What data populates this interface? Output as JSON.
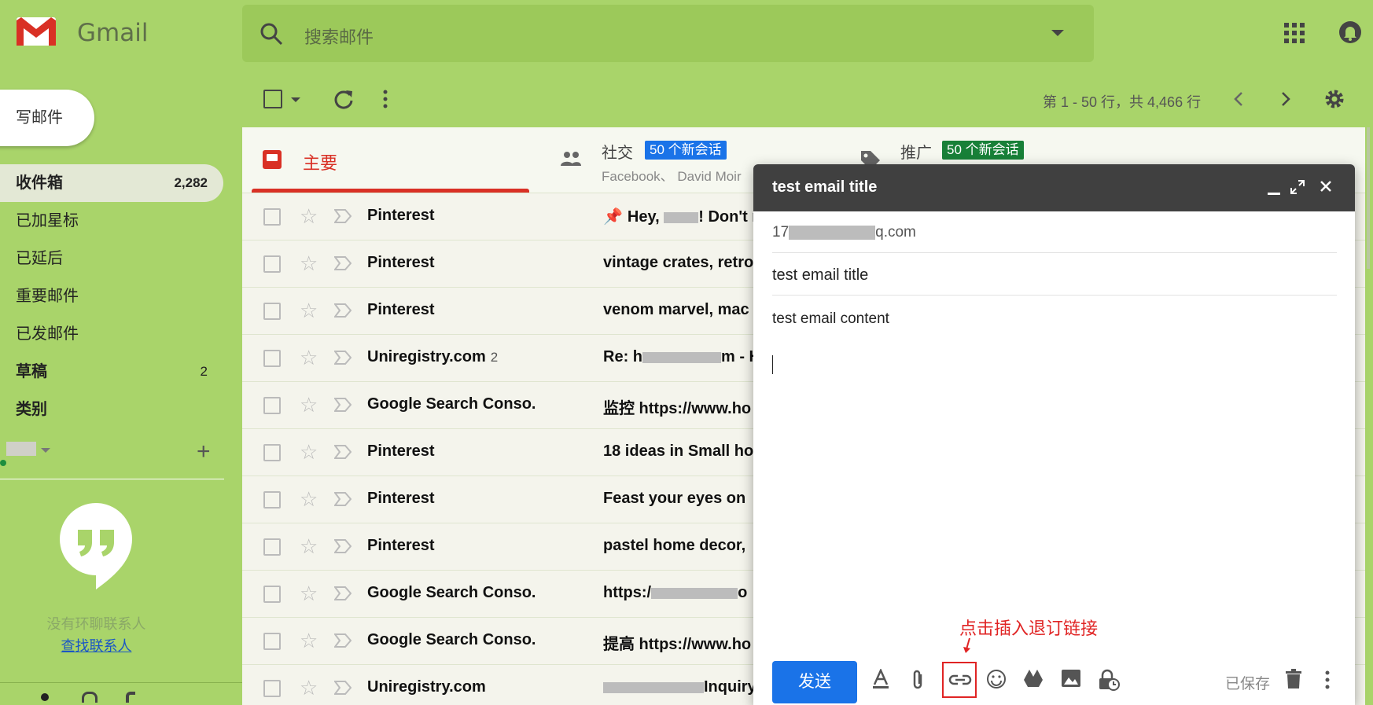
{
  "header": {
    "logo_text": "Gmail",
    "search_placeholder": "搜索邮件"
  },
  "sidebar": {
    "compose_label": "写邮件",
    "items": [
      {
        "label": "收件箱",
        "count": "2,282"
      },
      {
        "label": "已加星标",
        "count": ""
      },
      {
        "label": "已延后",
        "count": ""
      },
      {
        "label": "重要邮件",
        "count": ""
      },
      {
        "label": "已发邮件",
        "count": ""
      },
      {
        "label": "草稿",
        "count": "2"
      },
      {
        "label": "类别",
        "count": ""
      }
    ],
    "hangouts": {
      "empty_text": "没有环聊联系人",
      "find_link": "查找联系人"
    }
  },
  "toolbar": {
    "range_text": "第 1 - 50 行，共 4,466 行"
  },
  "tabs": [
    {
      "label": "主要"
    },
    {
      "label": "社交",
      "badge": "50 个新会话",
      "senders": "Facebook、 David Moir"
    },
    {
      "label": "推广",
      "badge": "50 个新会话"
    }
  ],
  "emails": [
    {
      "sender": "Pinterest",
      "thread_count": "",
      "subject": "Hey, ",
      "subject_tail": "! Don't m"
    },
    {
      "sender": "Pinterest",
      "thread_count": "",
      "subject": "vintage crates, retro",
      "subject_tail": ""
    },
    {
      "sender": "Pinterest",
      "thread_count": "",
      "subject": "venom marvel, mac",
      "subject_tail": ""
    },
    {
      "sender": "Uniregistry.com",
      "thread_count": "2",
      "subject": "Re: h",
      "subject_tail": "m - H"
    },
    {
      "sender": "Google Search Conso.",
      "thread_count": "",
      "subject": "监控 https://www.ho",
      "subject_tail": ""
    },
    {
      "sender": "Pinterest",
      "thread_count": "",
      "subject": "18 ideas in Small ho",
      "subject_tail": ""
    },
    {
      "sender": "Pinterest",
      "thread_count": "",
      "subject": "Feast your eyes on",
      "subject_tail": ""
    },
    {
      "sender": "Pinterest",
      "thread_count": "",
      "subject": "pastel home decor,",
      "subject_tail": ""
    },
    {
      "sender": "Google Search Conso.",
      "thread_count": "",
      "subject": "https:/",
      "subject_tail": "o"
    },
    {
      "sender": "Google Search Conso.",
      "thread_count": "",
      "subject": "提高 https://www.ho",
      "subject_tail": ""
    },
    {
      "sender": "Uniregistry.com",
      "thread_count": "",
      "subject": "",
      "subject_tail": "Inquiry"
    }
  ],
  "compose": {
    "window_title": "test email title",
    "to_prefix": "17",
    "to_suffix": "q.com",
    "subject": "test email title",
    "body": "test email content",
    "send_label": "发送",
    "saved_label": "已保存",
    "annotation": "点击插入退订链接"
  },
  "colors": {
    "theme_background": "#a9d46a",
    "primary_tab": "#d93025",
    "social_badge": "#1a73e8",
    "promo_badge": "#188038",
    "send_button": "#1a73e8",
    "annotation": "#e02424"
  },
  "icons": [
    "gmail-logo-icon",
    "search-icon",
    "apps-grid-icon",
    "notifications-icon",
    "refresh-icon",
    "more-vert-icon",
    "chevron-left-icon",
    "chevron-right-icon",
    "settings-gear-icon",
    "inbox-icon",
    "people-icon",
    "tag-icon",
    "star-icon",
    "important-marker-icon",
    "hangouts-icon",
    "formatting-icon",
    "attachment-icon",
    "insert-link-icon",
    "emoji-icon",
    "drive-icon",
    "photo-icon",
    "confidential-mode-icon",
    "trash-icon",
    "minimize-icon",
    "expand-icon",
    "close-icon"
  ]
}
